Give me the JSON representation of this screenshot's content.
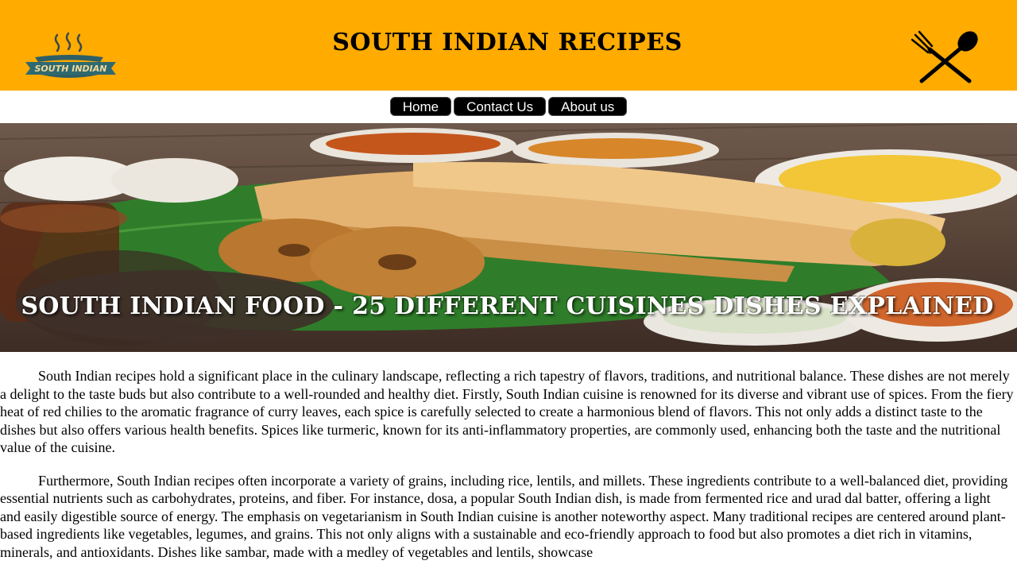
{
  "header": {
    "logo_text": "SOUTH INDIAN",
    "title": "SOUTH INDIAN RECIPES",
    "logo_icon": "steaming-bowl-icon",
    "cutlery_icon": "fork-spoon-icon",
    "background_color": "#ffab00"
  },
  "nav": {
    "items": [
      {
        "label": "Home"
      },
      {
        "label": "Contact Us"
      },
      {
        "label": "About us"
      }
    ]
  },
  "hero": {
    "title": "SOUTH INDIAN FOOD - 25 DIFFERENT CUISINES DISHES EXPLAINED",
    "image_subject": "dosa, vada, idli and chutneys on banana leaf"
  },
  "content": {
    "paragraphs": [
      "South Indian recipes hold a significant place in the culinary landscape, reflecting a rich tapestry of flavors, traditions, and nutritional balance. These dishes are not merely a delight to the taste buds but also contribute to a well-rounded and healthy diet. Firstly, South Indian cuisine is renowned for its diverse and vibrant use of spices. From the fiery heat of red chilies to the aromatic fragrance of curry leaves, each spice is carefully selected to create a harmonious blend of flavors. This not only adds a distinct taste to the dishes but also offers various health benefits. Spices like turmeric, known for its anti-inflammatory properties, are commonly used, enhancing both the taste and the nutritional value of the cuisine.",
      "Furthermore, South Indian recipes often incorporate a variety of grains, including rice, lentils, and millets. These ingredients contribute to a well-balanced diet, providing essential nutrients such as carbohydrates, proteins, and fiber. For instance, dosa, a popular South Indian dish, is made from fermented rice and urad dal batter, offering a light and easily digestible source of energy. The emphasis on vegetarianism in South Indian cuisine is another noteworthy aspect. Many traditional recipes are centered around plant-based ingredients like vegetables, legumes, and grains. This not only aligns with a sustainable and eco-friendly approach to food but also promotes a diet rich in vitamins, minerals, and antioxidants. Dishes like sambar, made with a medley of vegetables and lentils, showcase"
    ]
  }
}
